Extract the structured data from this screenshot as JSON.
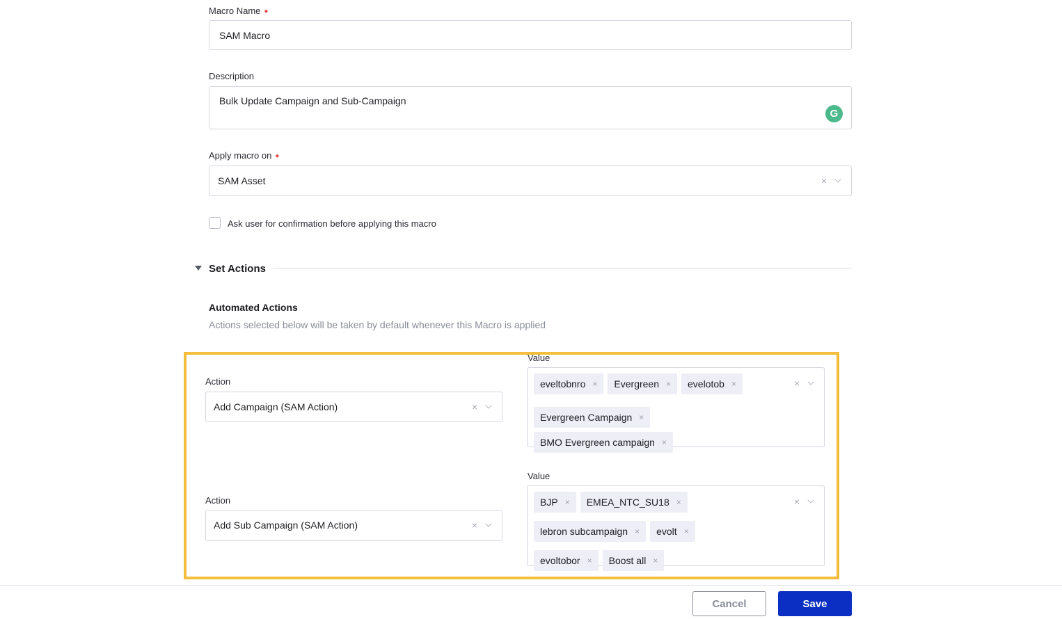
{
  "form": {
    "macro_name": {
      "label": "Macro Name",
      "required": true,
      "value": "SAM Macro"
    },
    "description": {
      "label": "Description",
      "value": "Bulk Update Campaign and Sub-Campaign",
      "assist_icon": "grammarly-icon"
    },
    "apply_on": {
      "label": "Apply macro on",
      "required": true,
      "value": "SAM Asset"
    },
    "confirmation": {
      "label": "Ask user for confirmation before applying this macro",
      "checked": false
    }
  },
  "set_actions": {
    "title": "Set Actions",
    "expanded": true,
    "automated": {
      "title": "Automated Actions",
      "description": "Actions selected below will be taken by default whenever this Macro is applied"
    },
    "rows": [
      {
        "action_label": "Action",
        "action_value": "Add Campaign (SAM Action)",
        "value_label": "Value",
        "values": [
          "eveltobnro",
          "Evergreen",
          "evelotob",
          "Evergreen Campaign",
          "BMO Evergreen campaign"
        ]
      },
      {
        "action_label": "Action",
        "action_value": "Add Sub Campaign (SAM Action)",
        "value_label": "Value",
        "values": [
          "BJP",
          "EMEA_NTC_SU18",
          "lebron subcampaign",
          "evolt",
          "evoltobor",
          "Boost all"
        ]
      }
    ]
  },
  "colors": {
    "highlight": "#f4bd3b",
    "primary": "#0a2fc2",
    "required": "#e5484d"
  },
  "footer": {
    "cancel_label": "Cancel",
    "save_label": "Save"
  }
}
